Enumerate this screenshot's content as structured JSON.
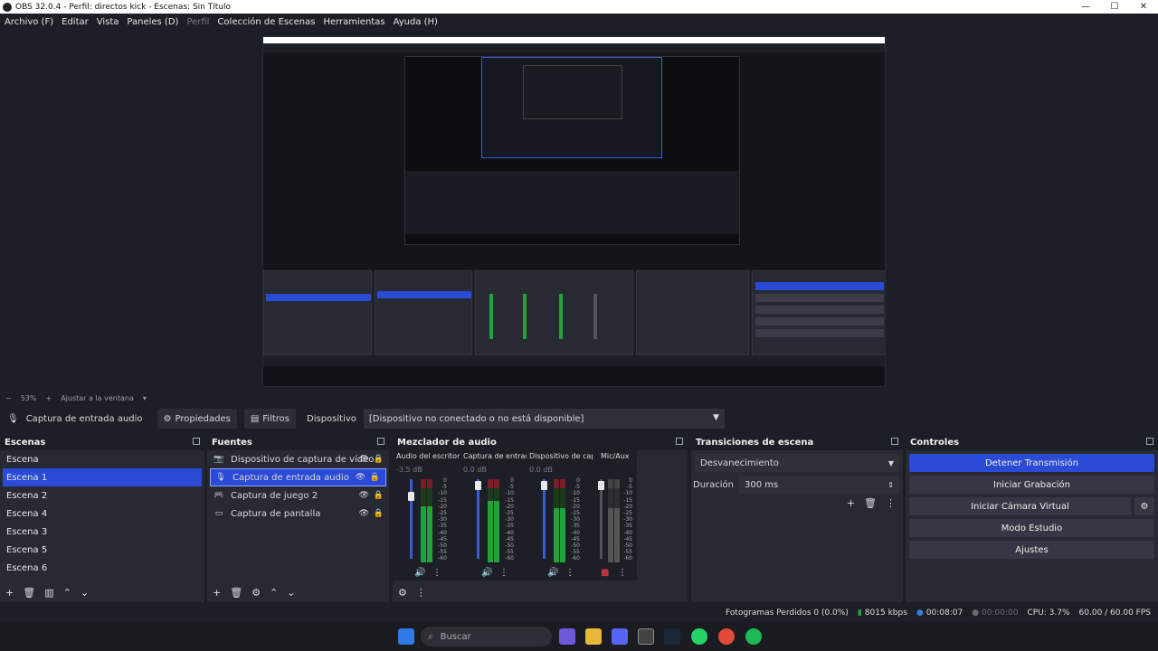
{
  "window": {
    "title": "OBS 32.0.4 - Perfil: directos kick - Escenas: Sin Título"
  },
  "menu": [
    {
      "label": "Archivo (F)",
      "enabled": true
    },
    {
      "label": "Editar",
      "enabled": true
    },
    {
      "label": "Vista",
      "enabled": true
    },
    {
      "label": "Paneles (D)",
      "enabled": true
    },
    {
      "label": "Perfil",
      "enabled": false
    },
    {
      "label": "Colección de Escenas",
      "enabled": true
    },
    {
      "label": "Herramientas",
      "enabled": true
    },
    {
      "label": "Ayuda (H)",
      "enabled": true
    }
  ],
  "zoom": {
    "minus": "−",
    "level": "53%",
    "plus": "+",
    "fit": "Ajustar a la ventana"
  },
  "source_toolbar": {
    "source_name": "Captura de entrada audio",
    "properties": "Propiedades",
    "filters": "Filtros",
    "device_label": "Dispositivo",
    "device_value": "[Dispositivo no conectado o no está disponible]"
  },
  "scenes": {
    "title": "Escenas",
    "items": [
      "Escena",
      "Escena 1",
      "Escena 2",
      "Escena 4",
      "Escena 3",
      "Escena 5",
      "Escena 6"
    ],
    "selected": "Escena 1"
  },
  "sources": {
    "title": "Fuentes",
    "items": [
      {
        "label": "Dispositivo de captura de vídeo",
        "icon": "camera-icon"
      },
      {
        "label": "Captura de entrada audio",
        "icon": "microphone-icon"
      },
      {
        "label": "Captura de juego 2",
        "icon": "gamepad-icon"
      },
      {
        "label": "Captura de pantalla",
        "icon": "monitor-icon"
      }
    ],
    "selected": "Captura de entrada audio"
  },
  "mixer": {
    "title": "Mezclador de audio",
    "channels": [
      {
        "name": "Audio del escritorio",
        "db": "-3.5 dB"
      },
      {
        "name": "Captura de entrada",
        "db": "0.0 dB"
      },
      {
        "name": "Dispositivo de capt",
        "db": "0.0 dB"
      },
      {
        "name": "Mic/Aux",
        "db": ""
      }
    ],
    "scale": [
      "0",
      "-5",
      "-10",
      "-15",
      "-20",
      "-25",
      "-30",
      "-35",
      "-40",
      "-45",
      "-50",
      "-55",
      "-60"
    ]
  },
  "transitions": {
    "title": "Transiciones de escena",
    "selected": "Desvanecimiento",
    "duration_label": "Duración",
    "duration_value": "300 ms"
  },
  "controls": {
    "title": "Controles",
    "buttons": [
      "Detener Transmisión",
      "Iniciar Grabación",
      "Iniciar Cámara Virtual",
      "Modo Estudio",
      "Ajustes"
    ]
  },
  "status": {
    "dropped": "Fotogramas Perdidos 0 (0.0%)",
    "bitrate": "8015 kbps",
    "stream_time": "00:08:07",
    "rec_time": "00:00:00",
    "cpu": "CPU: 3.7%",
    "fps": "60.00 / 60.00 FPS"
  },
  "taskbar": {
    "search": "Buscar"
  },
  "colors": {
    "accent": "#2b4ad6",
    "bg": "#1d1f26",
    "panel": "#272a33"
  }
}
